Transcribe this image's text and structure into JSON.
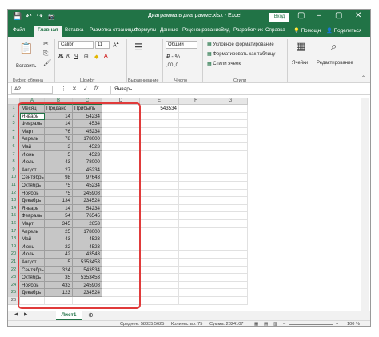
{
  "titlebar": {
    "title": "Диаграмма в диаграмме.xlsx - Excel",
    "signin": "Вход",
    "qat": {
      "save": "💾",
      "undo": "↶",
      "redo": "↷",
      "camera": "📷"
    }
  },
  "tabs": [
    "Файл",
    "Главная",
    "Вставка",
    "Разметка страницы",
    "Формулы",
    "Данные",
    "Рецензирование",
    "Вид",
    "Разработчик",
    "Справка",
    "Помощн",
    "Поделиться"
  ],
  "ribbon": {
    "paste_label": "Вставить",
    "clipboard_group": "Буфер обмена",
    "font_name": "Calibri",
    "font_size": "11",
    "font_group": "Шрифт",
    "align_group": "Выравнивание",
    "number_format": "Общий",
    "number_group": "Число",
    "cond_format": "Условное форматирование",
    "format_table": "Форматировать как таблицу",
    "cell_styles": "Стили ячеек",
    "styles_group": "Стили",
    "cells_label": "Ячейки",
    "editing_label": "Редактирование"
  },
  "formula_bar": {
    "name_box": "A2",
    "fx": "fx",
    "value": "Январь"
  },
  "columns": [
    "A",
    "B",
    "C",
    "D",
    "E",
    "F",
    "G"
  ],
  "row_numbers": [
    "1",
    "2",
    "3",
    "4",
    "5",
    "6",
    "7",
    "8",
    "9",
    "10",
    "11",
    "12",
    "13",
    "14",
    "15",
    "16",
    "17",
    "18",
    "19",
    "20",
    "21",
    "22",
    "23",
    "24",
    "25",
    "26"
  ],
  "header_row": {
    "a": "Месяц",
    "b": "Продано",
    "c": "Прибыль",
    "e": "543534"
  },
  "rows": [
    {
      "month": "Январь",
      "sold": "14",
      "profit": "54234"
    },
    {
      "month": "Февраль",
      "sold": "14",
      "profit": "4534"
    },
    {
      "month": "Март",
      "sold": "76",
      "profit": "45234"
    },
    {
      "month": "Апрель",
      "sold": "78",
      "profit": "178000"
    },
    {
      "month": "Май",
      "sold": "3",
      "profit": "4523"
    },
    {
      "month": "Июнь",
      "sold": "5",
      "profit": "4523"
    },
    {
      "month": "Июль",
      "sold": "43",
      "profit": "78000"
    },
    {
      "month": "Август",
      "sold": "27",
      "profit": "45234"
    },
    {
      "month": "Сентябрь",
      "sold": "98",
      "profit": "97643"
    },
    {
      "month": "Октябрь",
      "sold": "75",
      "profit": "45234"
    },
    {
      "month": "Ноябрь",
      "sold": "75",
      "profit": "245908"
    },
    {
      "month": "Декабрь",
      "sold": "134",
      "profit": "234524"
    },
    {
      "month": "Январь",
      "sold": "14",
      "profit": "54234"
    },
    {
      "month": "Февраль",
      "sold": "54",
      "profit": "76545"
    },
    {
      "month": "Март",
      "sold": "345",
      "profit": "2653"
    },
    {
      "month": "Апрель",
      "sold": "25",
      "profit": "178000"
    },
    {
      "month": "Май",
      "sold": "43",
      "profit": "4523"
    },
    {
      "month": "Июнь",
      "sold": "22",
      "profit": "4523"
    },
    {
      "month": "Июль",
      "sold": "42",
      "profit": "43543"
    },
    {
      "month": "Август",
      "sold": "5",
      "profit": "5353453"
    },
    {
      "month": "Сентябрь",
      "sold": "324",
      "profit": "543534"
    },
    {
      "month": "Октябрь",
      "sold": "35",
      "profit": "5353453"
    },
    {
      "month": "Ноябрь",
      "sold": "433",
      "profit": "245908"
    },
    {
      "month": "Декабрь",
      "sold": "123",
      "profit": "234524"
    }
  ],
  "sheet": {
    "tab": "Лист1"
  },
  "status": {
    "average": "Среднее: 58835,5625",
    "count": "Количество: 75",
    "sum": "Сумма: 2824107",
    "zoom": "100 %"
  },
  "colors": {
    "excel_green": "#217346",
    "highlight_frame": "#e03a3a",
    "selection_gray": "#c6c6c6"
  }
}
